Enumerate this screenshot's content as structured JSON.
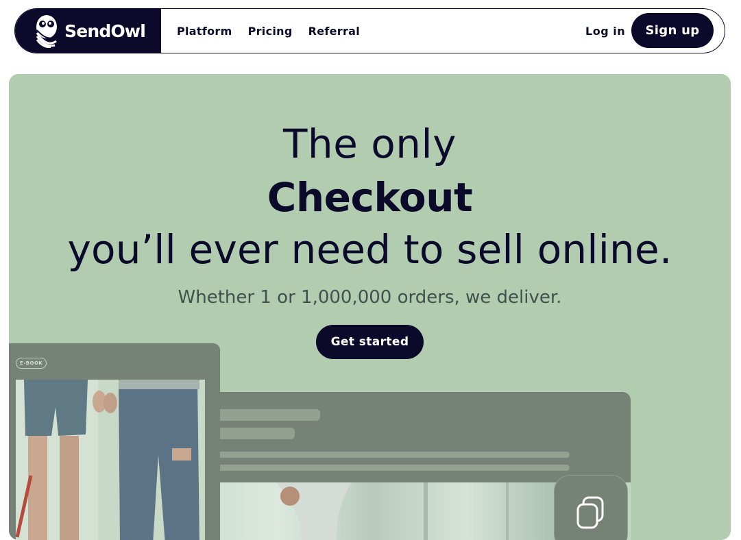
{
  "brand": {
    "name": "SendOwl",
    "logo_icon": "owl-logo-icon"
  },
  "nav": {
    "links": [
      "Platform",
      "Pricing",
      "Referral"
    ],
    "login_label": "Log in",
    "signup_label": "Sign up"
  },
  "hero": {
    "line1": "The only",
    "line2": "Checkout",
    "line3": "you’ll ever need to sell online.",
    "subtitle": "Whether 1 or 1,000,000 orders, we deliver.",
    "cta_label": "Get started"
  },
  "mockup": {
    "ebook_badge": "E-BOOK",
    "tile_icon": "stacked-pages-icon"
  },
  "colors": {
    "navy": "#0b0a2a",
    "hero_bg": "#b2ccb0",
    "card_bg": "#758275",
    "white": "#ffffff"
  }
}
